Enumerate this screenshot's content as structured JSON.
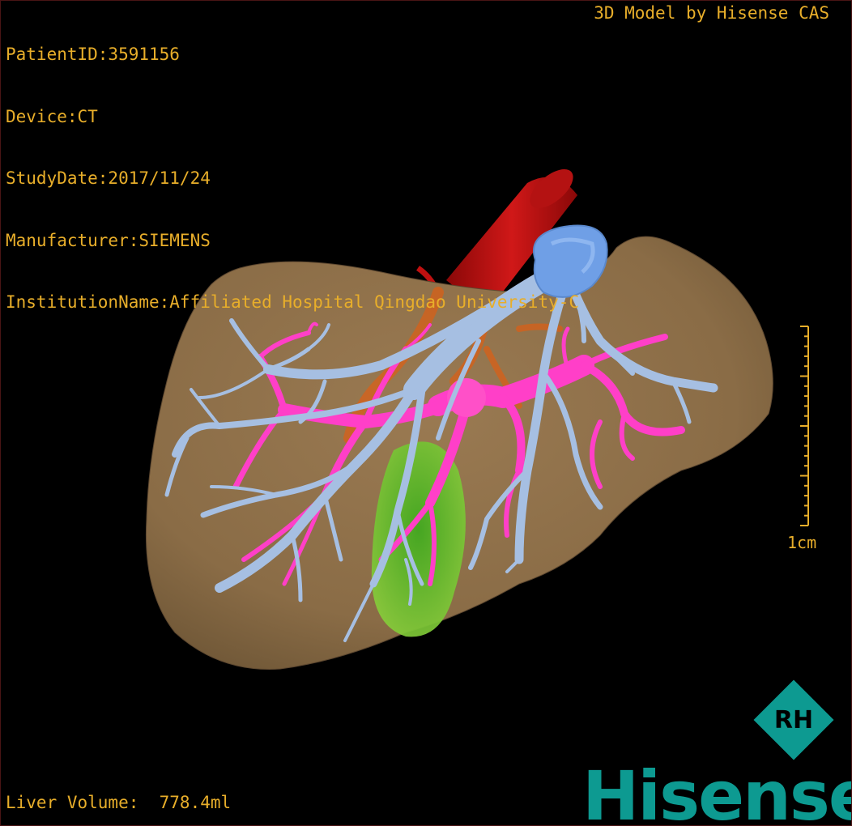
{
  "patient_info": {
    "patient_id": "PatientID:3591156",
    "device": "Device:CT",
    "study_date": "StudyDate:2017/11/24",
    "manufacturer": "Manufacturer:SIEMENS",
    "institution": "InstitutionName:Affiliated Hospital Qingdao University-C"
  },
  "model_credit": "3D Model by Hisense CAS",
  "liver_volume": "Liver Volume:  778.4ml",
  "scale_bar": {
    "label": "1cm"
  },
  "logo": {
    "wordmark": "Hisense",
    "badge": "RH"
  },
  "colors": {
    "overlay_text": "#e8ae2a",
    "liver": "#8c6e48",
    "portal_vein": "#ff46c8",
    "hepatic_vein": "#a8c0e0",
    "ivc_cap": "#6fa0e6",
    "artery": "#c81010",
    "gallbladder": "#6ac82a",
    "brand": "#0d9a91"
  },
  "icons": [
    "rh-badge-icon"
  ]
}
